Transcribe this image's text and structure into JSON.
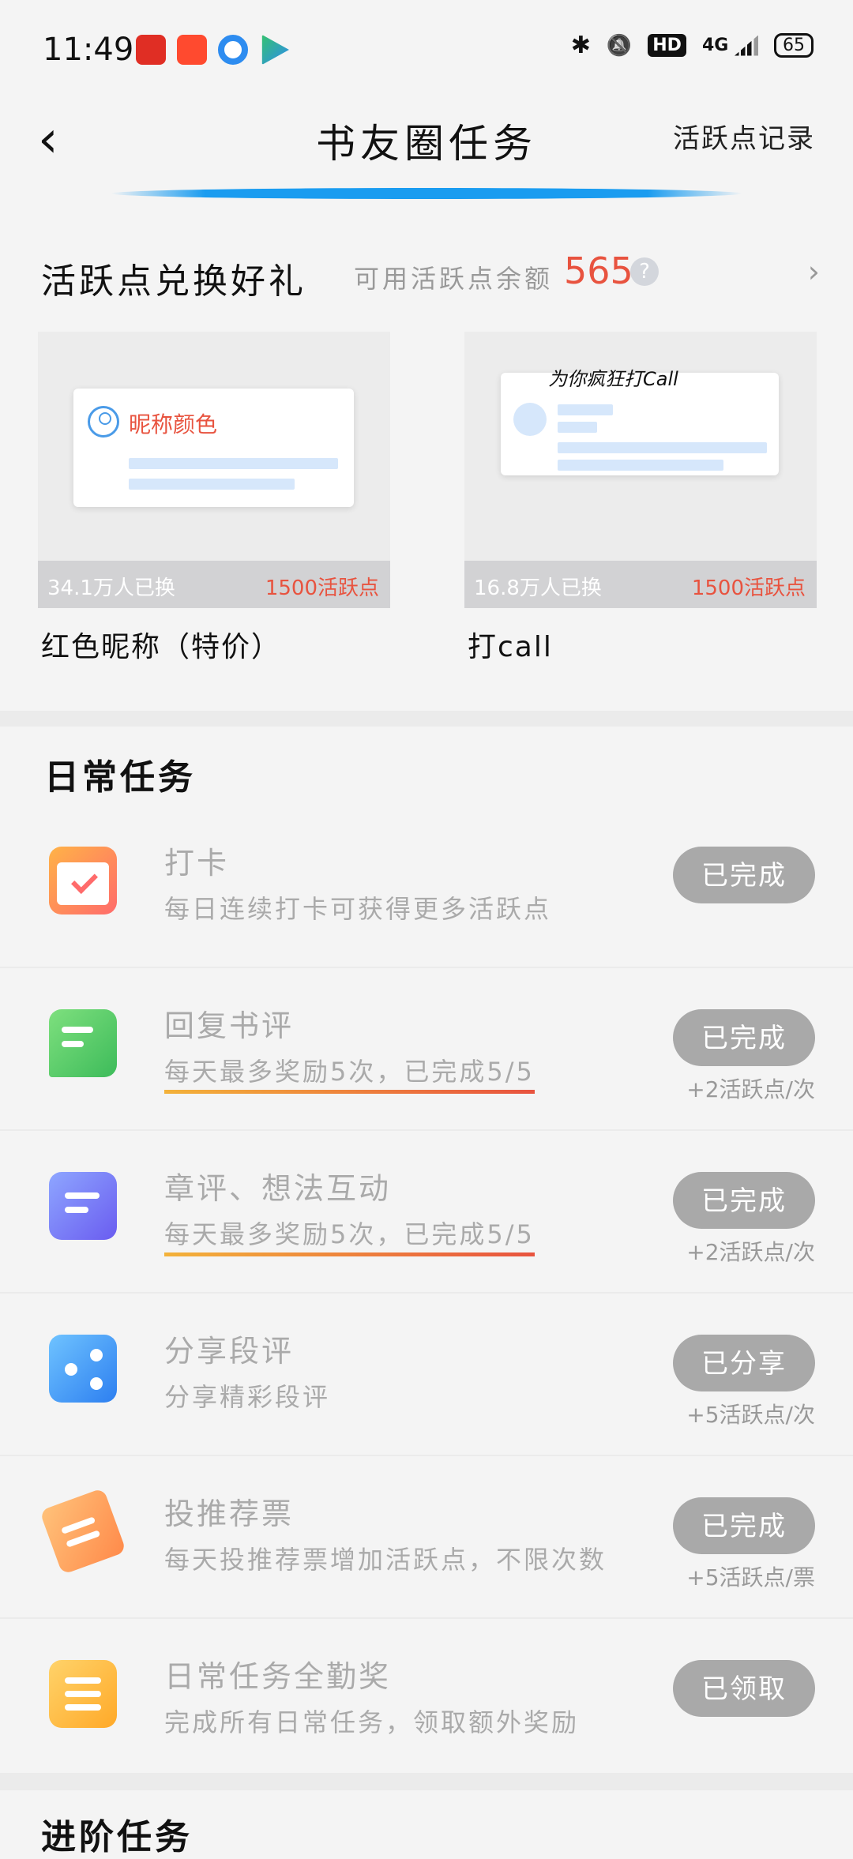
{
  "status_bar": {
    "time": "11:49",
    "bluetooth": "✱",
    "mute": "🔕",
    "hd": "HD",
    "network": "4G",
    "battery": "65"
  },
  "header": {
    "back": "‹",
    "title": "书友圈任务",
    "record_link": "活跃点记录"
  },
  "exchange": {
    "title": "活跃点兑换好礼",
    "balance_label": "可用活跃点余额",
    "balance": "565",
    "help": "?",
    "arrow": "›",
    "items": [
      {
        "card_text": "昵称颜色",
        "redeemed": "34.1万人已换",
        "cost": "1500活跃点",
        "name": "红色昵称（特价）"
      },
      {
        "card_text": "为你疯狂打Call",
        "redeemed": "16.8万人已换",
        "cost": "1500活跃点",
        "name": "打call"
      }
    ]
  },
  "daily": {
    "title": "日常任务",
    "tasks": [
      {
        "icon": "calendar-icon",
        "name": "打卡",
        "desc": "每日连续打卡可获得更多活跃点",
        "button": "已完成",
        "note": ""
      },
      {
        "icon": "chat-icon",
        "name": "回复书评",
        "desc": "每天最多奖励5次，已完成5/5",
        "button": "已完成",
        "note": "+2活跃点/次"
      },
      {
        "icon": "document-icon",
        "name": "章评、想法互动",
        "desc": "每天最多奖励5次，已完成5/5",
        "button": "已完成",
        "note": "+2活跃点/次"
      },
      {
        "icon": "share-icon",
        "name": "分享段评",
        "desc": "分享精彩段评",
        "button": "已分享",
        "note": "+5活跃点/次"
      },
      {
        "icon": "ticket-icon",
        "name": "投推荐票",
        "desc": "每天投推荐票增加活跃点，不限次数",
        "button": "已完成",
        "note": "+5活跃点/票"
      },
      {
        "icon": "list-icon",
        "name": "日常任务全勤奖",
        "desc": "完成所有日常任务，领取额外奖励",
        "button": "已领取",
        "note": ""
      }
    ]
  },
  "advanced": {
    "title": "进阶任务"
  },
  "colors": {
    "accent_blue": "#1a9cf0",
    "balance_red": "#e8533f",
    "button_gray": "#a9a9a9"
  }
}
